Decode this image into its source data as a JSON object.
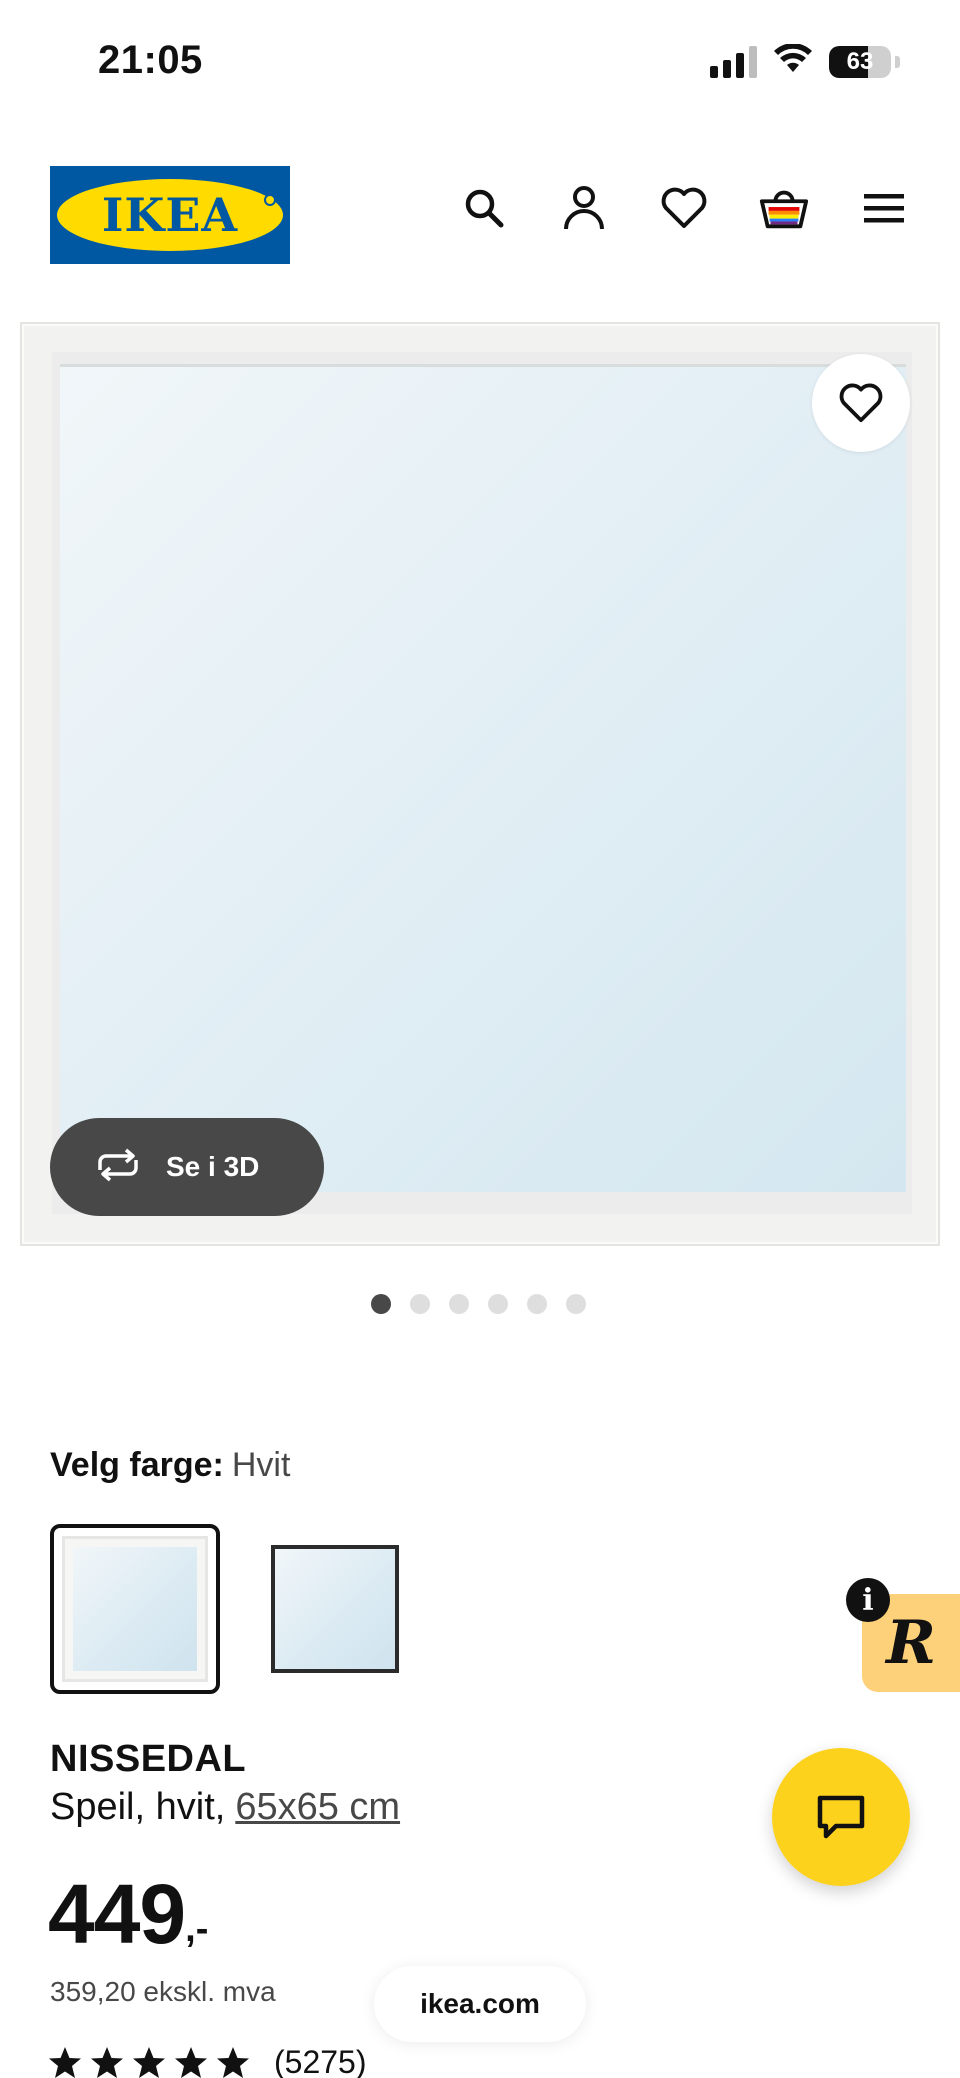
{
  "status_bar": {
    "time": "21:05",
    "battery": "63",
    "battery_level": 0.63
  },
  "header": {
    "logo_text": "IKEA",
    "icons": [
      "search-icon",
      "account-icon",
      "heart-icon",
      "cart-icon",
      "menu-icon"
    ]
  },
  "gallery": {
    "view_3d_label": "Se i 3D",
    "dot_count": 6,
    "active_dot": 1
  },
  "color": {
    "label": "Velg farge:",
    "value": "Hvit",
    "options": [
      "white",
      "black"
    ],
    "selected": "white"
  },
  "product": {
    "name": "NISSEDAL",
    "description": "Speil, hvit,",
    "size": "65x65 cm",
    "price": "449",
    "price_suffix": ",-",
    "price_ex_vat": "359,20 ekskl. mva",
    "rating_stars": 5,
    "rating_count": "(5275)"
  },
  "floating": {
    "r_badge": "R",
    "info_badge": "i",
    "url": "ikea.com"
  },
  "colors": {
    "ikea_blue": "#0058a3",
    "ikea_yellow": "#ffdb00",
    "chat_yellow": "#fcd21c",
    "pill_gray": "#484848"
  }
}
